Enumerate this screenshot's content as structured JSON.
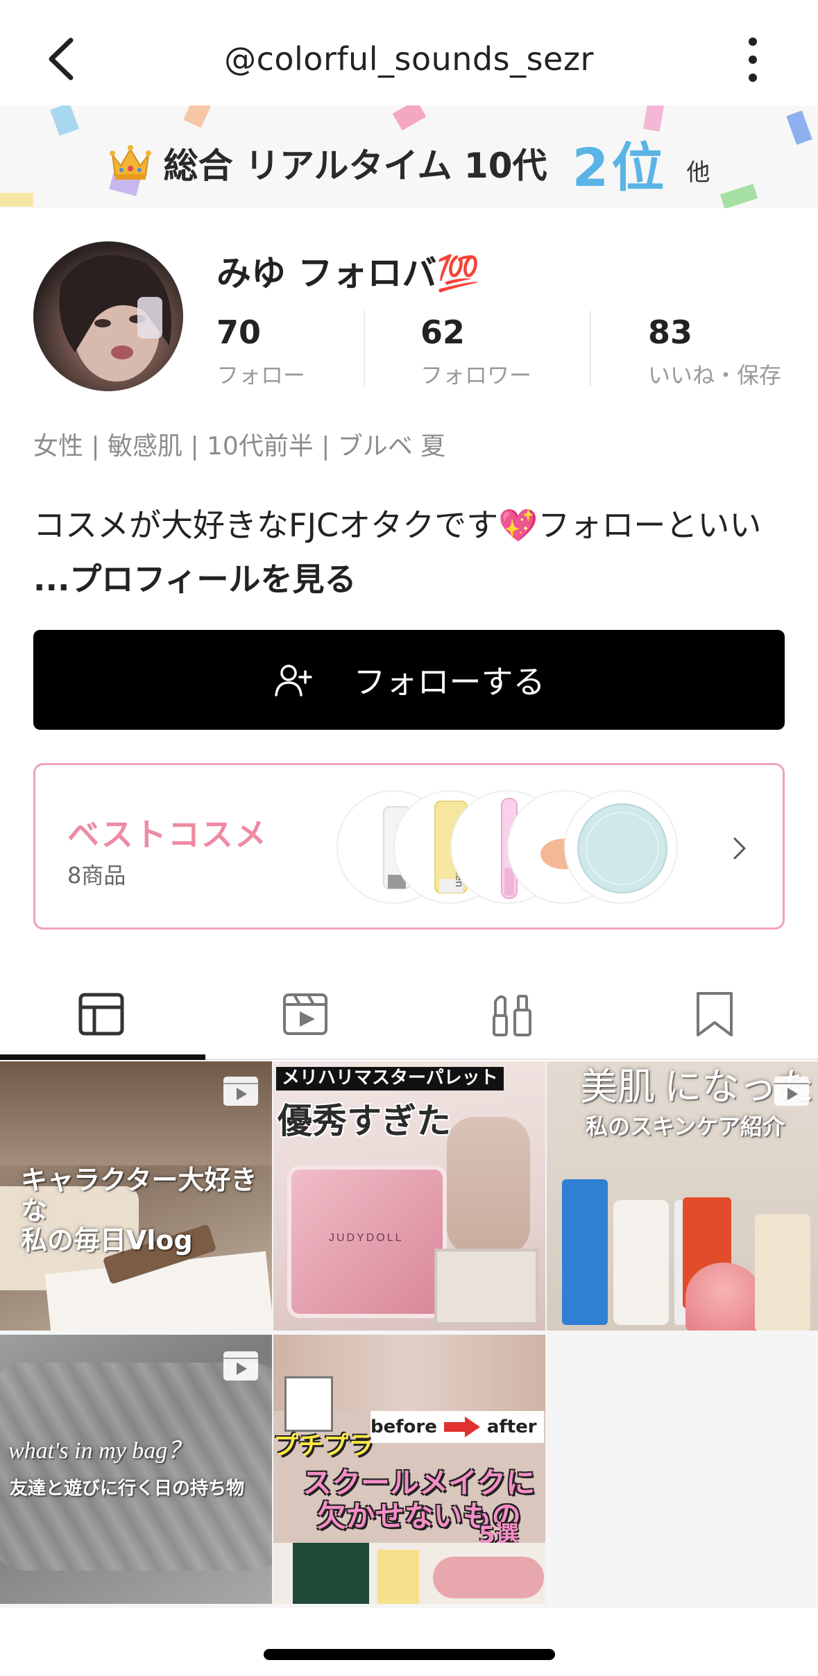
{
  "header": {
    "title": "@colorful_sounds_sezr"
  },
  "ranking": {
    "label": "総合 リアルタイム 10代",
    "value": "2位",
    "other": "他"
  },
  "profile": {
    "name": "みゆ  フォロバ💯",
    "stats": [
      {
        "num": "70",
        "label": "フォロー"
      },
      {
        "num": "62",
        "label": "フォロワー"
      },
      {
        "num": "83",
        "label": "いいね・保存"
      }
    ],
    "tags": "女性 | 敏感肌 | 10代前半 | ブルベ 夏",
    "bio": "コスメが大好きなFJCオタクです💖フォローといい ",
    "bio_more": "...プロフィールを見る",
    "follow_label": "フォローする"
  },
  "best_cosme": {
    "title": "ベストコスメ",
    "count": "8商品"
  },
  "posts": [
    {
      "title": "キャラクター大好きな\n私の毎日Vlog",
      "video": true
    },
    {
      "title_top": "メリハリマスターパレット",
      "title_main": "優秀すぎた",
      "brand": "JUDYDOLL",
      "video": false
    },
    {
      "title_top": "美肌 になった",
      "title_main": "私のスキンケア紹介",
      "video": true
    },
    {
      "title_script": "what's in my bag？",
      "title_main": "友達と遊びに行く日の持ち物",
      "video": true
    },
    {
      "before": "before",
      "after": "after",
      "sticker": "プチプラ",
      "title_main": "スクールメイクに\n欠かせないもの",
      "count": "5選",
      "video": false
    }
  ],
  "colors": {
    "accent_rank": "#5ab4e6",
    "best_pink": "#ee8aa2",
    "follow_bg": "#000000"
  }
}
